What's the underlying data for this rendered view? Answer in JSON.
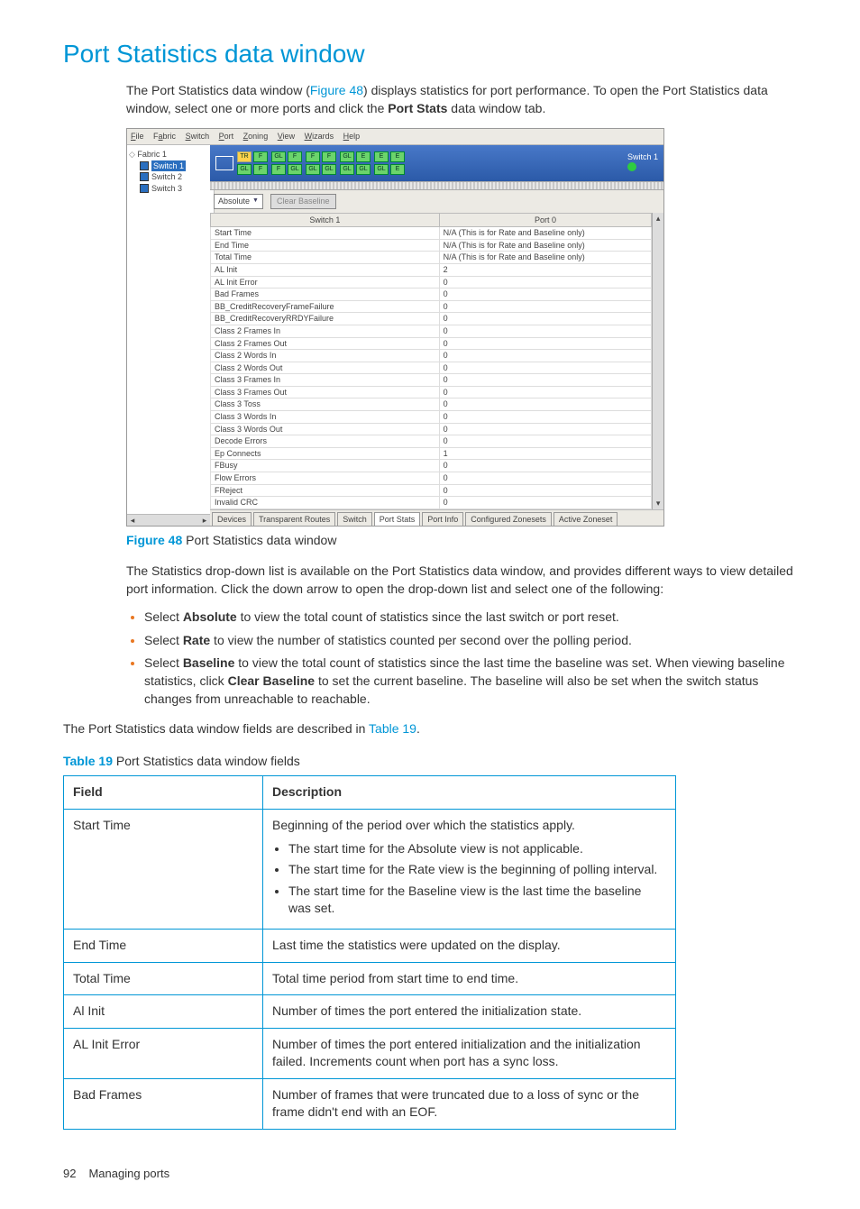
{
  "title": "Port Statistics data window",
  "intro": {
    "part1": "The Port Statistics data window (",
    "link1": "Figure 48",
    "part2": ") displays statistics for port performance. To open the Port Statistics data window, select one or more ports and click the ",
    "bold1": "Port Stats",
    "part3": " data window tab."
  },
  "figure": {
    "label": "Figure 48",
    "caption": " Port Statistics data window"
  },
  "app": {
    "menus": [
      "File",
      "Fabric",
      "Switch",
      "Port",
      "Zoning",
      "View",
      "Wizards",
      "Help"
    ],
    "tree_root": "Fabric 1",
    "tree_items": [
      "Switch 1",
      "Switch 2",
      "Switch 3"
    ],
    "switch_name": "Switch 1",
    "dropdown": "Absolute",
    "clear_btn": "Clear Baseline",
    "headers": [
      "Switch 1",
      "Port 0"
    ],
    "rows": [
      [
        "Start Time",
        "N/A (This is for Rate and Baseline only)"
      ],
      [
        "End Time",
        "N/A (This is for Rate and Baseline only)"
      ],
      [
        "Total Time",
        "N/A (This is for Rate and Baseline only)"
      ],
      [
        "AL Init",
        "2"
      ],
      [
        "AL Init Error",
        "0"
      ],
      [
        "Bad Frames",
        "0"
      ],
      [
        "BB_CreditRecoveryFrameFailure",
        "0"
      ],
      [
        "BB_CreditRecoveryRRDYFailure",
        "0"
      ],
      [
        "Class 2 Frames In",
        "0"
      ],
      [
        "Class 2 Frames Out",
        "0"
      ],
      [
        "Class 2 Words In",
        "0"
      ],
      [
        "Class 2 Words Out",
        "0"
      ],
      [
        "Class 3 Frames In",
        "0"
      ],
      [
        "Class 3 Frames Out",
        "0"
      ],
      [
        "Class 3 Toss",
        "0"
      ],
      [
        "Class 3 Words In",
        "0"
      ],
      [
        "Class 3 Words Out",
        "0"
      ],
      [
        "Decode Errors",
        "0"
      ],
      [
        "Ep Connects",
        "1"
      ],
      [
        "FBusy",
        "0"
      ],
      [
        "Flow Errors",
        "0"
      ],
      [
        "FReject",
        "0"
      ],
      [
        "Invalid CRC",
        "0"
      ]
    ],
    "tabs": [
      "Devices",
      "Transparent Routes",
      "Switch",
      "Port Stats",
      "Port Info",
      "Configured Zonesets",
      "Active Zoneset"
    ],
    "active_tab_index": 3
  },
  "para2": "The Statistics drop-down list is available on the Port Statistics data window, and provides different ways to view detailed port information. Click the down arrow to open the drop-down list and select one of the following:",
  "bullets": [
    {
      "pre": "Select ",
      "b": "Absolute",
      "post": " to view the total count of statistics since the last switch or port reset."
    },
    {
      "pre": "Select ",
      "b": "Rate",
      "post": " to view the number of statistics counted per second over the polling period."
    },
    {
      "pre": "Select ",
      "b": "Baseline",
      "post": " to view the total count of statistics since the last time the baseline was set. When viewing baseline statistics, click ",
      "b2": "Clear Baseline",
      "post2": " to set the current baseline. The baseline will also be set when the switch status changes from unreachable to reachable."
    }
  ],
  "para3": {
    "pre": "The Port Statistics data window fields are described in ",
    "link": "Table 19",
    "post": "."
  },
  "table_caption": {
    "label": "Table 19",
    "text": "   Port Statistics data window fields"
  },
  "table": {
    "head": [
      "Field",
      "Description"
    ],
    "rows": [
      {
        "f": "Start Time",
        "d": "Beginning of the period over which the statistics apply.",
        "items": [
          "The start time for the Absolute view is not applicable.",
          "The start time for the Rate view is the beginning of polling interval.",
          "The start time for the Baseline view is the last time the baseline was set."
        ]
      },
      {
        "f": "End Time",
        "d": "Last time the statistics were updated on the display."
      },
      {
        "f": "Total Time",
        "d": "Total time period from start time to end time."
      },
      {
        "f": "Al Init",
        "d": "Number of times the port entered the initialization state."
      },
      {
        "f": "AL Init Error",
        "d": "Number of times the port entered initialization and the initialization failed. Increments count when port has a sync loss."
      },
      {
        "f": "Bad Frames",
        "d": "Number of frames that were truncated due to a loss of sync or the frame didn't end with an EOF."
      }
    ]
  },
  "footer": {
    "page": "92",
    "section": "Managing ports"
  }
}
